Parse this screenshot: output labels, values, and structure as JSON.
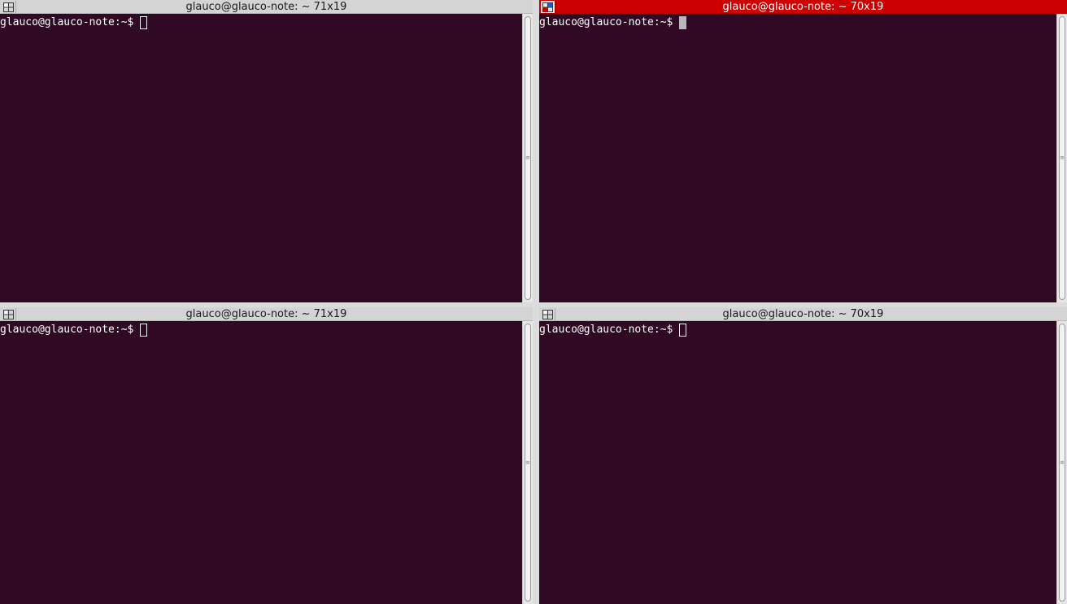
{
  "panes": [
    {
      "title": "glauco@glauco-note: ~ 71x19",
      "prompt": "glauco@glauco-note:~$ ",
      "active": false
    },
    {
      "title": "glauco@glauco-note: ~ 70x19",
      "prompt": "glauco@glauco-note:~$ ",
      "active": true
    },
    {
      "title": "glauco@glauco-note: ~ 71x19",
      "prompt": "glauco@glauco-note:~$ ",
      "active": false
    },
    {
      "title": "glauco@glauco-note: ~ 70x19",
      "prompt": "glauco@glauco-note:~$ ",
      "active": false
    }
  ],
  "colors": {
    "terminal_bg": "#300a24",
    "active_title_bg": "#cc0000",
    "inactive_title_bg": "#d4d4d4",
    "text": "#ffffff"
  },
  "icons": {
    "pane_menu": "grid-icon"
  }
}
